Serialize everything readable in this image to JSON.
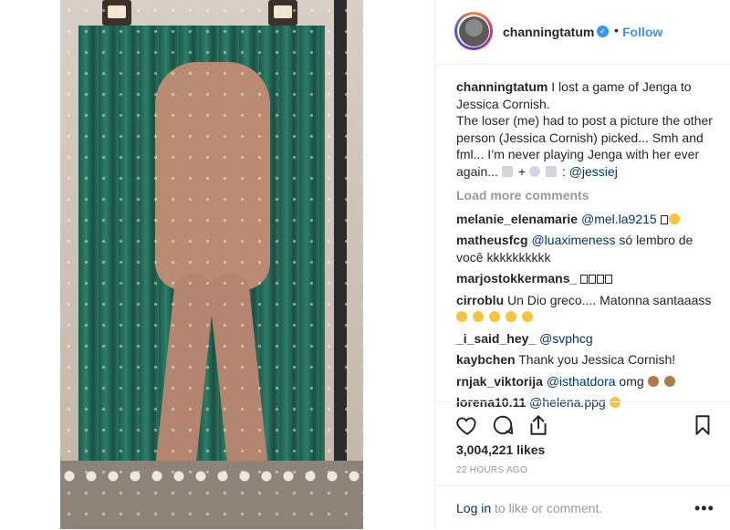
{
  "post": {
    "username": "channingtatum",
    "follow_label": "Follow",
    "dot": "•",
    "verified_glyph": "✓"
  },
  "caption": {
    "username": "channingtatum",
    "text_1": "I lost a game of Jenga to Jessica Cornish.",
    "text_2": "The loser (me) had to post a picture the other person (Jessica Cornish) picked... Smh and fml... I’m never playing Jenga with her ever again...",
    "plus": "+",
    "colon": ":",
    "mention": "@jessiej"
  },
  "load_more": "Load more comments",
  "comments": [
    {
      "user": "melanie_elenamarie",
      "mention": "@mel.la9215",
      "text": ""
    },
    {
      "user": "matheusfcg",
      "mention": "@luaximeness",
      "text": "só lembro de você kkkkkkkkkk"
    },
    {
      "user": "marjostokkermans_",
      "mention": "",
      "text": ""
    },
    {
      "user": "cirroblu",
      "mention": "",
      "text": "Un Dio greco.... Matonna santaaass"
    },
    {
      "user": "_i_said_hey_",
      "mention": "@svphcg",
      "text": ""
    },
    {
      "user": "kaybchen",
      "mention": "",
      "text": "Thank you Jessica Cornish!"
    },
    {
      "user": "rnjak_viktorija",
      "mention": "@isthatdora",
      "text": "omg"
    },
    {
      "user": "lorena10.11",
      "mention": "@helena.ppg",
      "text": ""
    }
  ],
  "likes": "3,004,221 likes",
  "time": "22 HOURS AGO",
  "login": {
    "link": "Log in",
    "text": "to like or comment."
  },
  "more_glyph": "•••",
  "icons": {
    "like": "heart-icon",
    "comment": "comment-icon",
    "share": "share-icon",
    "save": "bookmark-icon"
  },
  "colors": {
    "link_blue": "#3897f0",
    "mention_blue": "#003569",
    "muted": "#999999",
    "text": "#262626"
  }
}
